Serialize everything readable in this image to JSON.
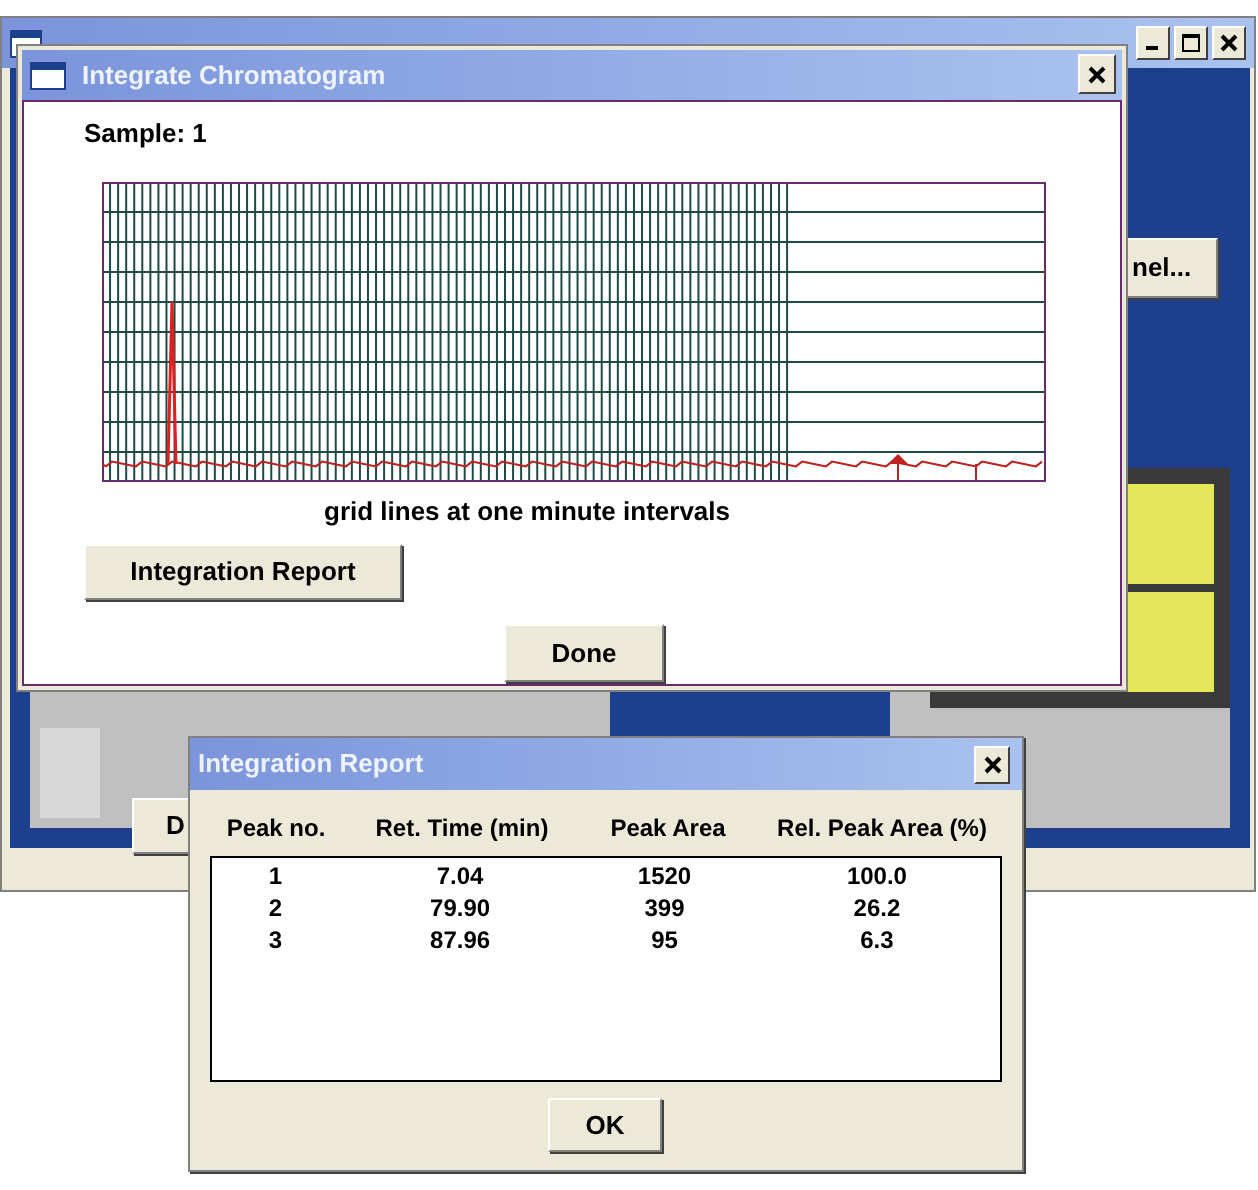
{
  "background_window": {
    "panel_button": "nel...",
    "partial_button": "D"
  },
  "chromatogram_dialog": {
    "title": "Integrate Chromatogram",
    "sample_label": "Sample: 1",
    "caption": "grid lines at one minute intervals",
    "report_button": "Integration Report",
    "done_button": "Done"
  },
  "report_dialog": {
    "title": "Integration Report",
    "columns": [
      "Peak no.",
      "Ret. Time (min)",
      "Peak Area",
      "Rel. Peak Area (%)"
    ],
    "rows": [
      [
        "1",
        "7.04",
        "1520",
        "100.0"
      ],
      [
        "2",
        "79.90",
        "399",
        "26.2"
      ],
      [
        "3",
        "87.96",
        "95",
        "6.3"
      ]
    ],
    "ok_button": "OK"
  }
}
